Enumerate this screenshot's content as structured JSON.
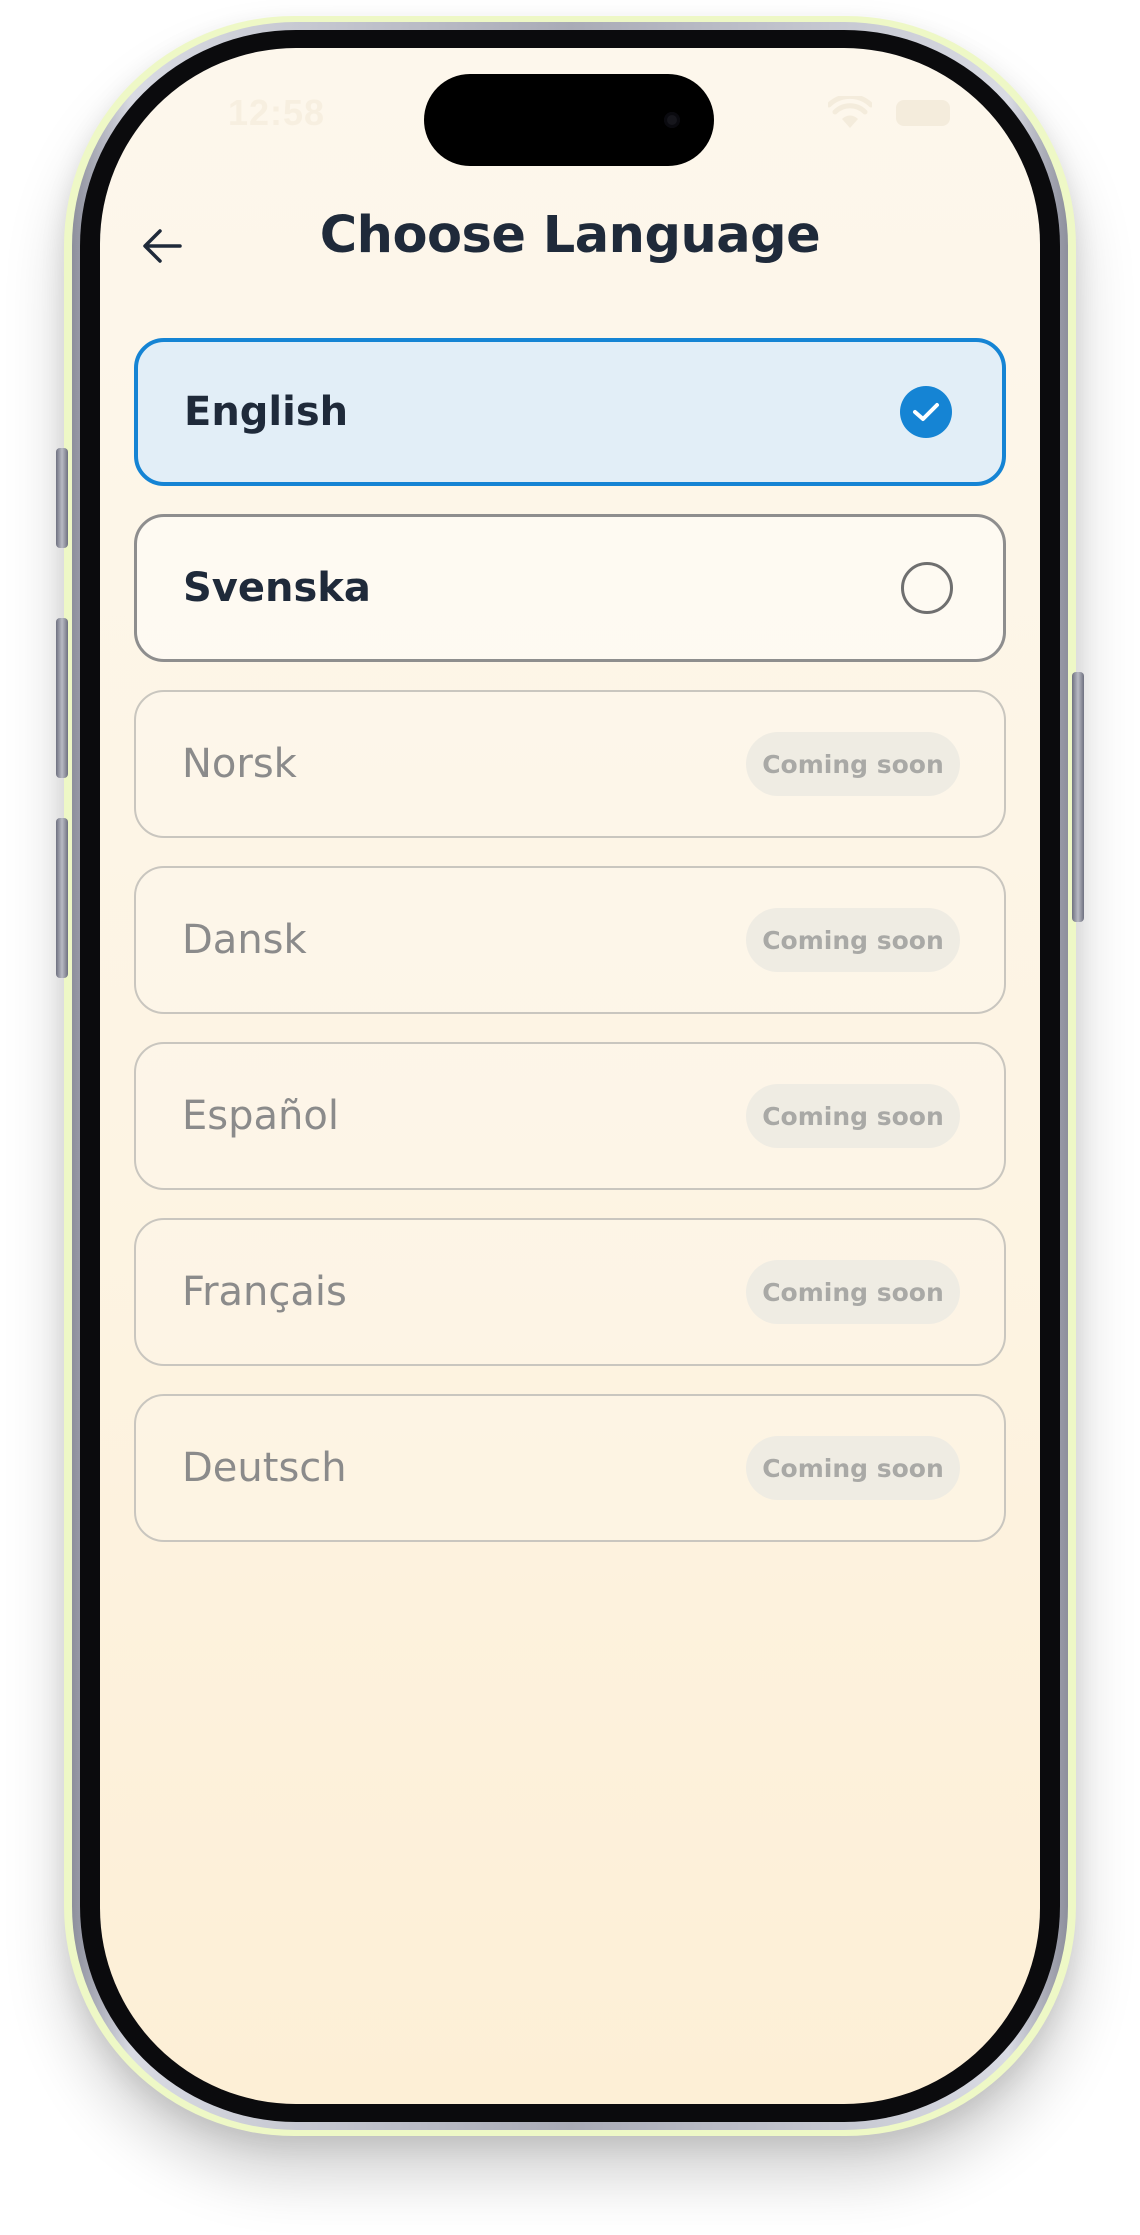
{
  "status_bar": {
    "time": "12:58",
    "wifi_icon": "wifi-icon",
    "battery_icon": "battery-icon"
  },
  "header": {
    "back_icon": "arrow-left-icon",
    "title": "Choose Language"
  },
  "languages": [
    {
      "label": "English",
      "state": "selected"
    },
    {
      "label": "Svenska",
      "state": "available"
    },
    {
      "label": "Norsk",
      "state": "coming_soon",
      "badge": "Coming soon"
    },
    {
      "label": "Dansk",
      "state": "coming_soon",
      "badge": "Coming soon"
    },
    {
      "label": "Español",
      "state": "coming_soon",
      "badge": "Coming soon"
    },
    {
      "label": "Français",
      "state": "coming_soon",
      "badge": "Coming soon"
    },
    {
      "label": "Deutsch",
      "state": "coming_soon",
      "badge": "Coming soon"
    }
  ],
  "colors": {
    "accent": "#1584d4",
    "selected_background": "#e2eef7",
    "title_text": "#1f2a3a",
    "disabled_text": "#8b8b8b",
    "badge_background": "#efece3"
  }
}
